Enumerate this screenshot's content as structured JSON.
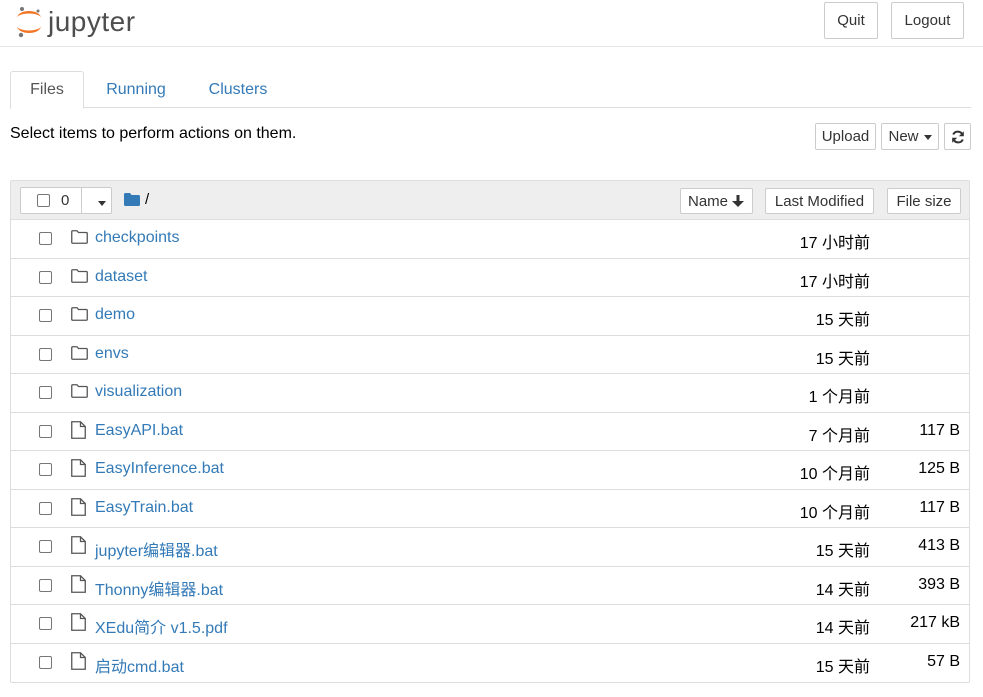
{
  "header": {
    "logo_text": "jupyter",
    "quit_label": "Quit",
    "logout_label": "Logout"
  },
  "tabs": [
    {
      "label": "Files",
      "active": true
    },
    {
      "label": "Running",
      "active": false
    },
    {
      "label": "Clusters",
      "active": false
    }
  ],
  "toolbar": {
    "instructions": "Select items to perform actions on them.",
    "upload_label": "Upload",
    "new_label": "New",
    "refresh_icon": "refresh-icon"
  },
  "list_header": {
    "selected_count": "0",
    "path": "/",
    "sort_name_label": "Name",
    "sort_modified_label": "Last Modified",
    "sort_size_label": "File size"
  },
  "colors": {
    "link": "#337ab7",
    "logo_orange": "#f37626",
    "folder_header_icon": "#337ab7"
  },
  "files": [
    {
      "name": "checkpoints",
      "type": "folder",
      "modified": "17 小时前",
      "size": ""
    },
    {
      "name": "dataset",
      "type": "folder",
      "modified": "17 小时前",
      "size": ""
    },
    {
      "name": "demo",
      "type": "folder",
      "modified": "15 天前",
      "size": ""
    },
    {
      "name": "envs",
      "type": "folder",
      "modified": "15 天前",
      "size": ""
    },
    {
      "name": "visualization",
      "type": "folder",
      "modified": "1 个月前",
      "size": ""
    },
    {
      "name": "EasyAPI.bat",
      "type": "file",
      "modified": "7 个月前",
      "size": "117 B"
    },
    {
      "name": "EasyInference.bat",
      "type": "file",
      "modified": "10 个月前",
      "size": "125 B"
    },
    {
      "name": "EasyTrain.bat",
      "type": "file",
      "modified": "10 个月前",
      "size": "117 B"
    },
    {
      "name": "jupyter编辑器.bat",
      "type": "file",
      "modified": "15 天前",
      "size": "413 B"
    },
    {
      "name": "Thonny编辑器.bat",
      "type": "file",
      "modified": "14 天前",
      "size": "393 B"
    },
    {
      "name": "XEdu简介 v1.5.pdf",
      "type": "file",
      "modified": "14 天前",
      "size": "217 kB"
    },
    {
      "name": "启动cmd.bat",
      "type": "file",
      "modified": "15 天前",
      "size": "57 B"
    }
  ]
}
